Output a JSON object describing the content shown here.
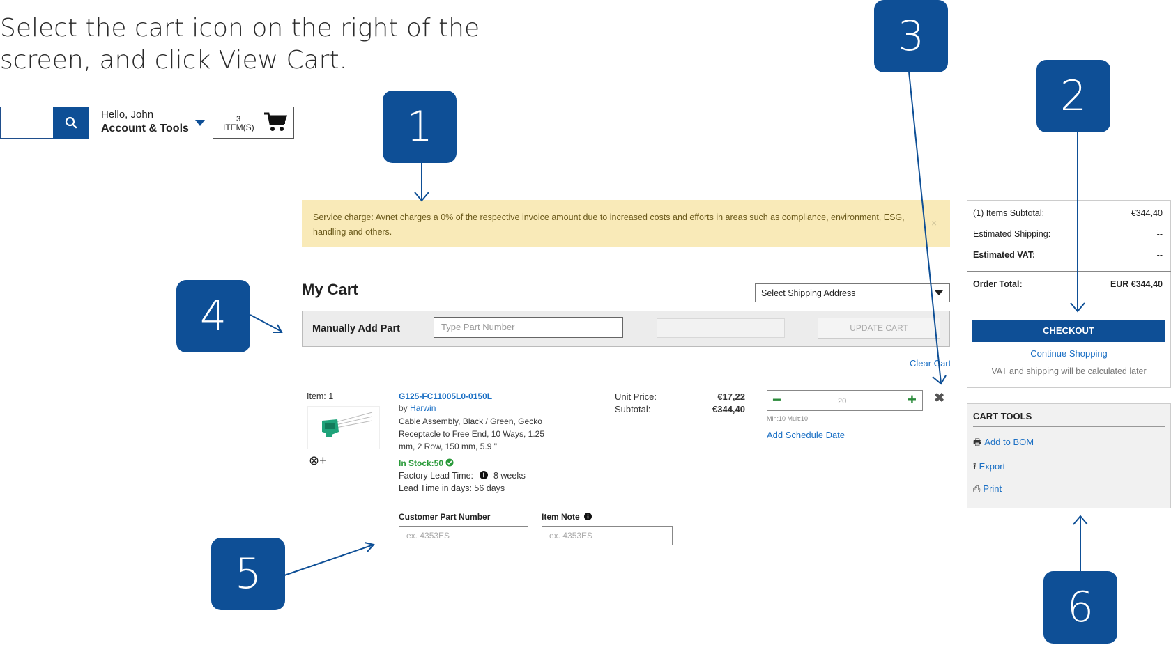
{
  "instruction": {
    "line1": "Select the cart icon on the right of the",
    "line2": "screen, and click View Cart."
  },
  "header": {
    "greeting": "Hello, John",
    "account_label": "Account & Tools",
    "cart_count": "3",
    "cart_items_label": "ITEM(S)"
  },
  "callouts": {
    "c1": "1",
    "c2": "2",
    "c3": "3",
    "c4": "4",
    "c5": "5",
    "c6": "6"
  },
  "banner": {
    "text": "Service charge: Avnet charges a 0% of the respective invoice amount due to increased costs and efforts in areas such as compliance, environment, ESG, handling and others.",
    "close": "×"
  },
  "cart": {
    "title": "My Cart",
    "shipping_select": "Select Shipping Address",
    "manual_add_label": "Manually Add Part",
    "part_number_placeholder": "Type Part Number",
    "update_button": "UPDATE CART",
    "clear_cart": "Clear Cart"
  },
  "item": {
    "item_label": "Item: 1",
    "part_number": "G125-FC11005L0-0150L",
    "by_label": "by",
    "manufacturer": "Harwin",
    "description": "Cable Assembly, Black / Green, Gecko Receptacle to Free End, 10 Ways, 1.25 mm, 2 Row, 150 mm, 5.9 \"",
    "in_stock": "In Stock:50",
    "factory_lead_label": "Factory Lead Time:",
    "factory_lead_value": "8 weeks",
    "lead_days": "Lead Time in days:  56 days",
    "unit_price_label": "Unit Price:",
    "subtotal_label": "Subtotal:",
    "unit_price": "€17,22",
    "subtotal": "€344,40",
    "quantity": "20",
    "minmult": "Min:10  Mult:10",
    "schedule_link": "Add Schedule Date",
    "compare_icon": "⊗+",
    "customer_part_label": "Customer Part Number",
    "item_note_label": "Item Note",
    "customer_part_placeholder": "ex. 4353ES",
    "item_note_placeholder": "ex. 4353ES"
  },
  "summary": {
    "items_subtotal_label": "(1) Items Subtotal:",
    "items_subtotal": "€344,40",
    "shipping_label": "Estimated Shipping:",
    "shipping": "--",
    "vat_label": "Estimated VAT:",
    "vat": "--",
    "order_total_label": "Order Total:",
    "order_total": "EUR €344,40",
    "checkout": "CHECKOUT",
    "continue": "Continue Shopping",
    "vat_note": "VAT and shipping will be calculated later"
  },
  "cart_tools": {
    "title": "CART TOOLS",
    "add_bom": "Add to BOM",
    "export": "Export",
    "print": "Print"
  },
  "colors": {
    "brand_blue": "#0e4f96",
    "link_blue": "#1a6fc4",
    "banner_bg": "#f9eab8",
    "stock_green": "#2a9a3a"
  },
  "icons": [
    "search-icon",
    "cart-icon",
    "chevron-down-icon",
    "close-icon",
    "compare-icon",
    "check-circle-icon",
    "info-icon",
    "minus-icon",
    "plus-icon",
    "remove-icon",
    "bom-icon",
    "export-icon",
    "print-icon"
  ]
}
